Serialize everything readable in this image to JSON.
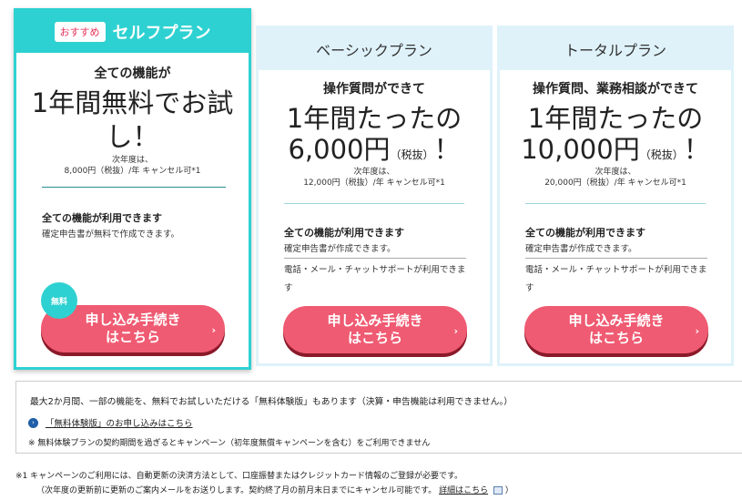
{
  "plans": [
    {
      "badge": "おすすめ",
      "name": "セルフプラン",
      "lead": "全ての機能が",
      "headline_1": "1年間無料でお試",
      "headline_2": "し！",
      "next_year_1": "次年度は、",
      "next_year_2": "8,000円（税抜）/年 キャンセル可*1",
      "feature_title": "全ての機能が利用できます",
      "feature_desc": "確定申告書が無料で作成できます。",
      "free_badge": "無料",
      "cta_1": "申し込み手続き",
      "cta_2": "はこちら",
      "arrow": "›"
    },
    {
      "name": "ベーシックプラン",
      "lead": "操作質問ができて",
      "headline_1": "1年間たったの",
      "price": "6,000円",
      "tax": "（税抜）",
      "exclaim": "！",
      "next_year_1": "次年度は、",
      "next_year_2": "12,000円（税抜）/年 キャンセル可*1",
      "feature_title": "全ての機能が利用できます",
      "feature_desc": "確定申告書が作成できます。",
      "support": "電話・メール・チャットサポートが利用できます",
      "cta_1": "申し込み手続き",
      "cta_2": "はこちら",
      "arrow": "›"
    },
    {
      "name": "トータルプラン",
      "lead": "操作質問、業務相談ができて",
      "headline_1": "1年間たったの",
      "price": "10,000円",
      "tax": "（税抜）",
      "exclaim": "！",
      "next_year_1": "次年度は、",
      "next_year_2": "20,000円（税抜）/年 キャンセル可*1",
      "feature_title": "全ての機能が利用できます",
      "feature_desc": "確定申告書が作成できます。",
      "support": "電話・メール・チャットサポートが利用できます",
      "cta_1": "申し込み手続き",
      "cta_2": "はこちら",
      "arrow": "›"
    }
  ],
  "trial": {
    "text": "最大2か月間、一部の機能を、無料でお試しいただける「無料体験版」もあります（決算・申告機能は利用できません。）",
    "link_icon": "›",
    "link": "「無料体験版」のお申し込みはこちら",
    "note": "※ 無料体験プランの契約期間を過ぎるとキャンペーン（初年度無償キャンペーンを含む）をご利用できません"
  },
  "footnote": {
    "line1": "※1 キャンペーンのご利用には、自動更新の決済方法として、口座振替またはクレジットカード情報のご登録が必要です。",
    "line2": "（次年度の更新前に更新のご案内メールをお送りします。契約終了月の前月末日までにキャンセル可能です。",
    "detail": "詳細はこちら",
    "close": "）"
  },
  "colors": {
    "accent": "#2ed1d1",
    "cta": "#ef5b72",
    "light_header": "#dff2fa"
  }
}
